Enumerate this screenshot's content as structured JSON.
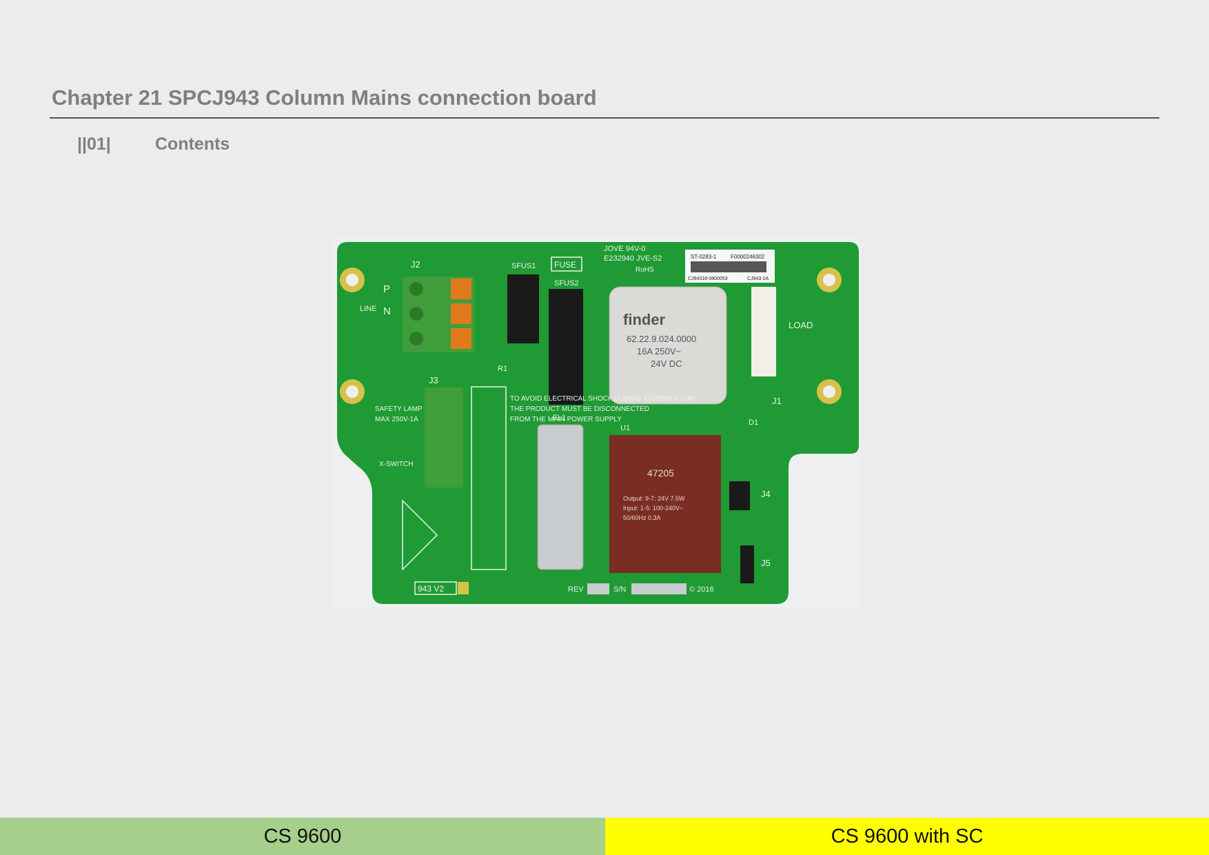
{
  "header": {
    "chapter_title": "Chapter 21 SPCJ943 Column Mains connection board",
    "section_number": "||01|",
    "section_title": "Contents"
  },
  "photo": {
    "labels": {
      "j2": "J2",
      "sfus1": "SFUS1",
      "fuse": "FUSE",
      "sfus2": "SFUS2",
      "p": "P",
      "n": "N",
      "line": "LINE",
      "j3": "J3",
      "r1": "R1",
      "fl1": "FL1",
      "u1": "U1",
      "safety_lamp": "SAFETY LAMP",
      "max_rating": "MAX 250V-1A",
      "x_switch": "X-SWITCH",
      "load": "LOAD",
      "j1": "J1",
      "d1": "D1",
      "j4": "J4",
      "j5": "J5",
      "warning_line1": "TO AVOID ELECTRICAL SHOCK DURING INTERVENTION",
      "warning_line2": "THE PRODUCT MUST BE DISCONNECTED",
      "warning_line3": "FROM THE MAIN POWER SUPPLY",
      "board_version": "943 V2",
      "rev": "REV",
      "sn": "S/N",
      "copyright": "© 2016",
      "jove_line1": "JOVE 94V-0",
      "jove_line2": "E232940 JVE-S2",
      "rohs": "RoHS",
      "label_code1": "ST-0283-1",
      "label_code2": "F0000246302",
      "label_code3": "CJ94318-0800053",
      "label_code4": "CJ943-2A",
      "relay_brand": "finder",
      "relay_model": "62.22.9.024.0000",
      "relay_rating": "16A 250V~",
      "relay_coil": "24V DC",
      "transformer_model": "47205",
      "transformer_spec1": "Output: 9-7: 24V 7.5W",
      "transformer_spec2": "Input: 1-5: 100-240V~",
      "transformer_spec3": "50/60Hz 0.3A"
    }
  },
  "footer": {
    "left_label": "CS 9600",
    "right_label": "CS 9600 with SC"
  },
  "colors": {
    "pcb_green": "#1f9a35",
    "footer_left_bg": "#a6cf8b",
    "footer_right_bg": "#ffff00"
  }
}
